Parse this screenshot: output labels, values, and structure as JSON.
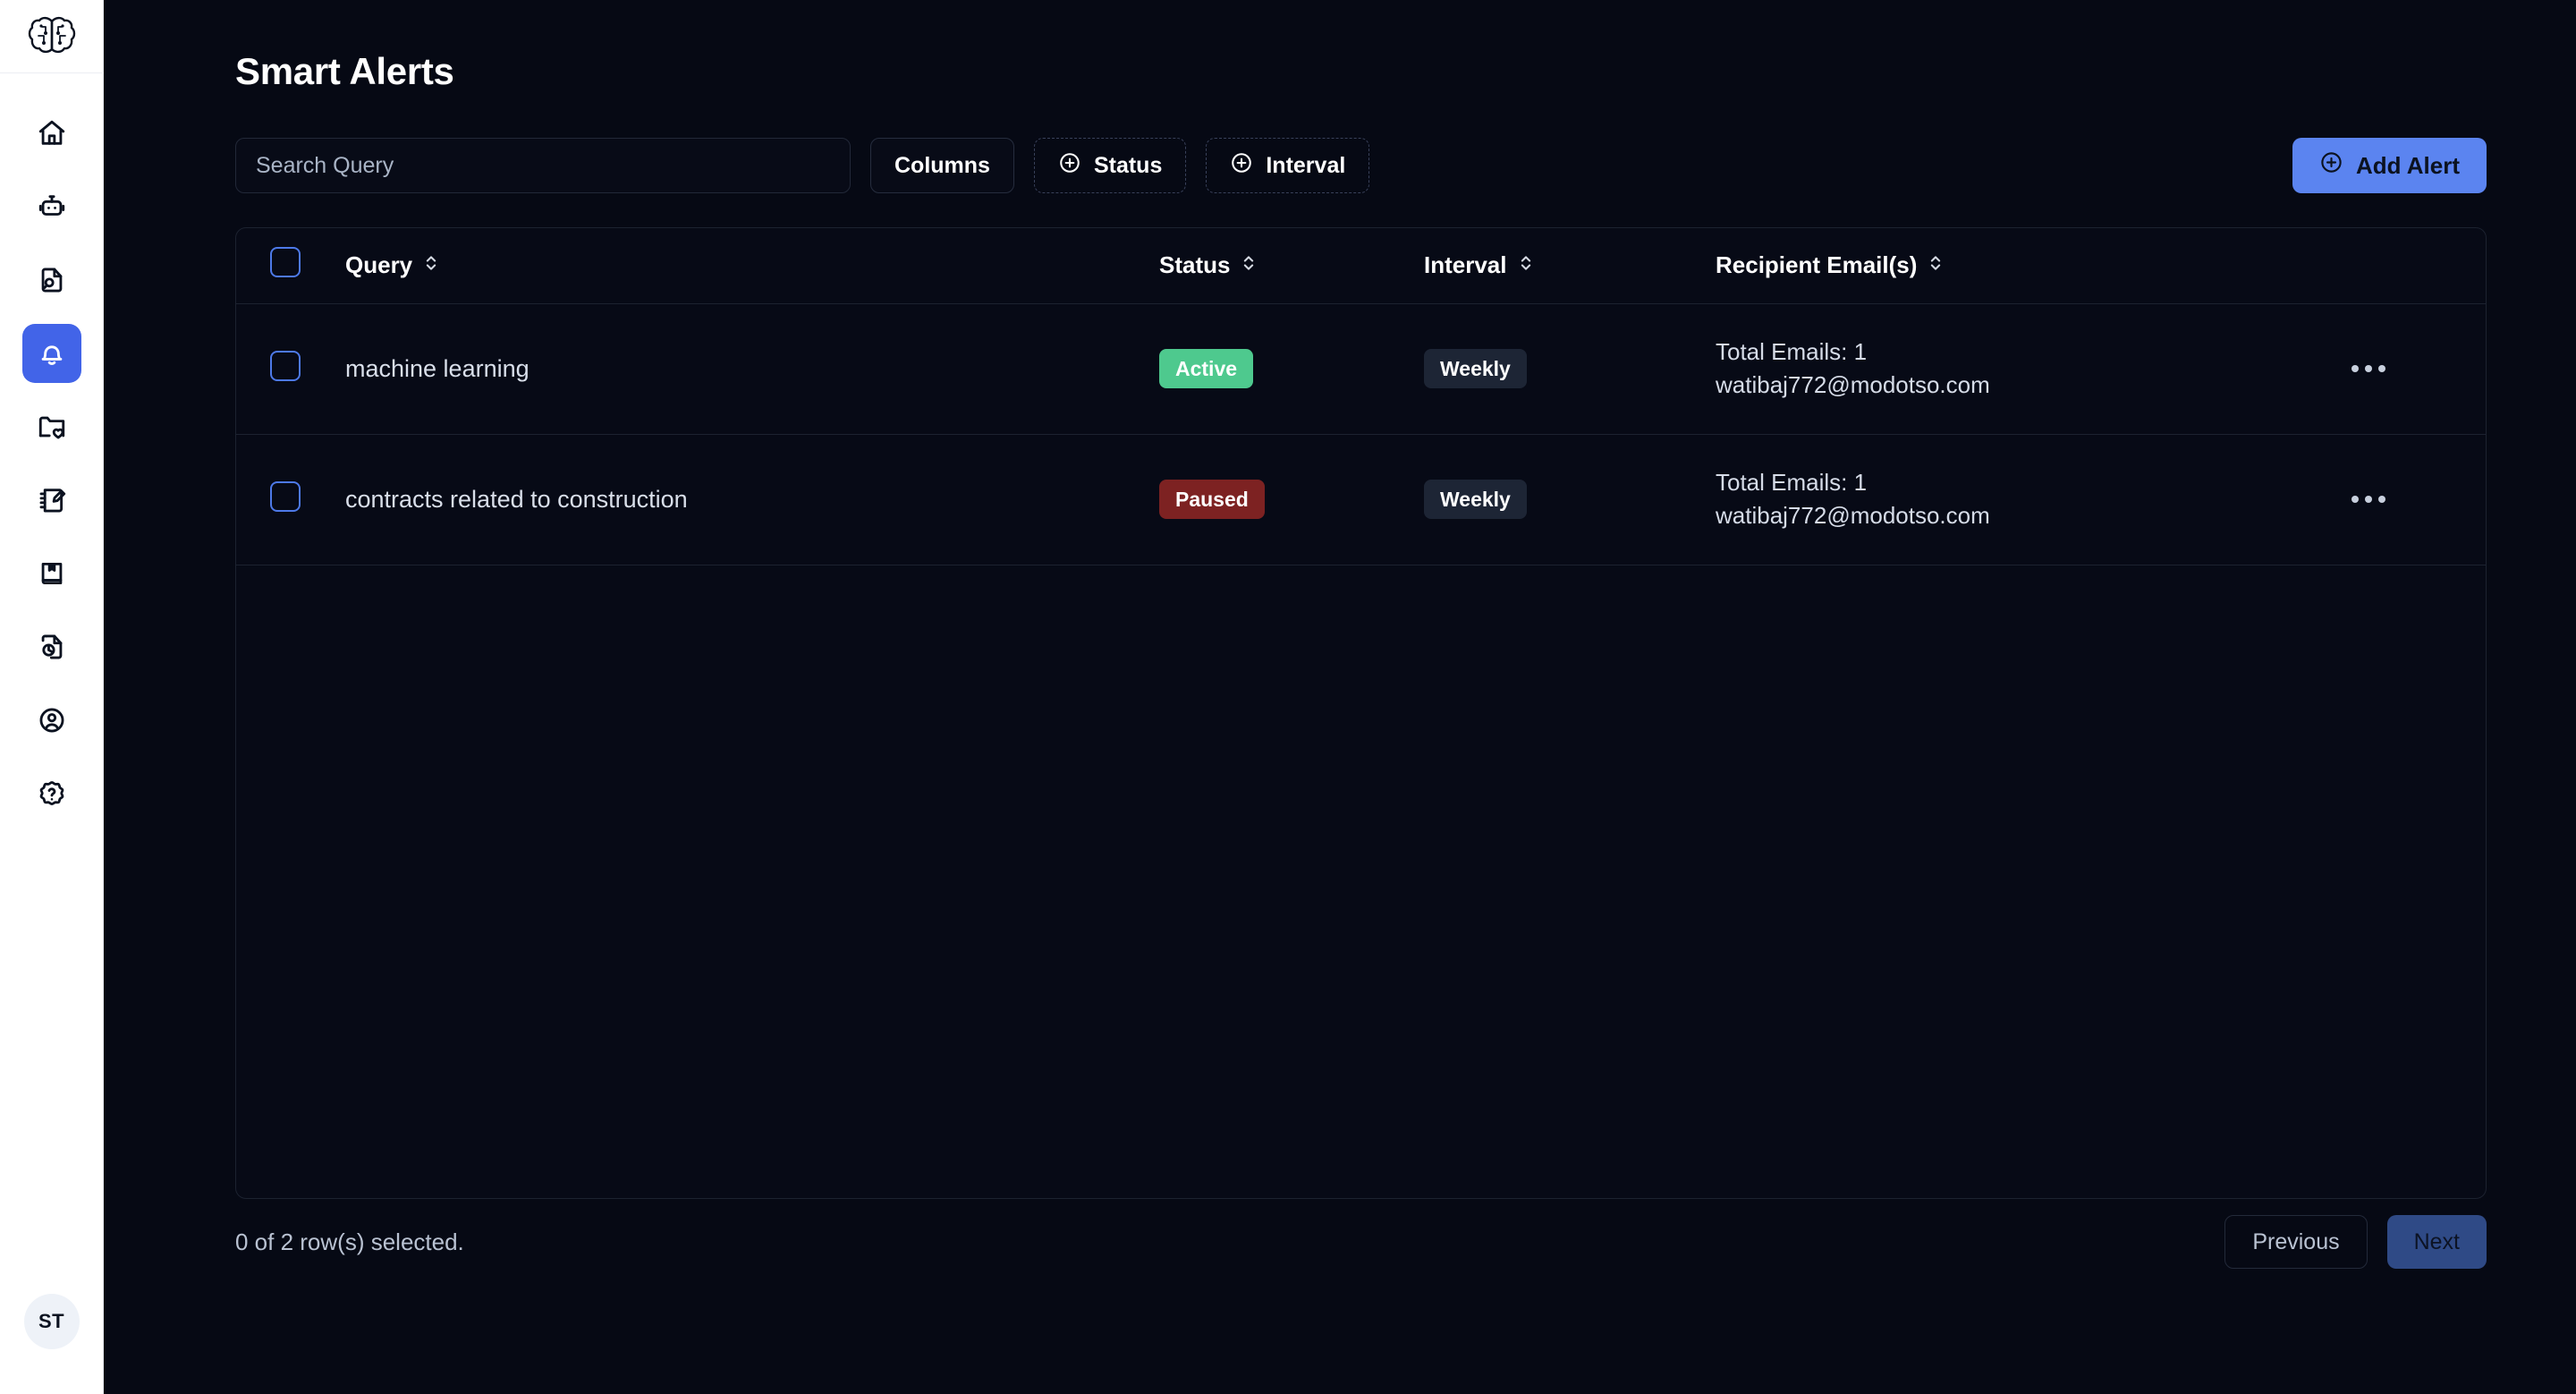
{
  "sidebar": {
    "logo": {
      "name": "brain-logo"
    },
    "items": [
      {
        "icon": "home-icon",
        "label": "Home",
        "active": false
      },
      {
        "icon": "robot-icon",
        "label": "Assistant",
        "active": false
      },
      {
        "icon": "file-search-icon",
        "label": "Search Docs",
        "active": false
      },
      {
        "icon": "bell-icon",
        "label": "Smart Alerts",
        "active": true
      },
      {
        "icon": "folder-heart-icon",
        "label": "Saved",
        "active": false
      },
      {
        "icon": "notebook-pen-icon",
        "label": "Notes",
        "active": false
      },
      {
        "icon": "book-bookmark-icon",
        "label": "Library",
        "active": false
      },
      {
        "icon": "file-chart-icon",
        "label": "Reports",
        "active": false
      },
      {
        "icon": "user-circle-icon",
        "label": "Account",
        "active": false
      },
      {
        "icon": "help-badge-icon",
        "label": "Help",
        "active": false
      }
    ],
    "avatar_initials": "ST"
  },
  "header": {
    "title": "Smart Alerts"
  },
  "toolbar": {
    "search_placeholder": "Search Query",
    "search_value": "",
    "columns_label": "Columns",
    "status_filter_label": "Status",
    "interval_filter_label": "Interval",
    "add_alert_label": "Add Alert"
  },
  "table": {
    "columns": [
      {
        "key": "query",
        "label": "Query",
        "sortable": true
      },
      {
        "key": "status",
        "label": "Status",
        "sortable": true
      },
      {
        "key": "interval",
        "label": "Interval",
        "sortable": true
      },
      {
        "key": "email",
        "label": "Recipient Email(s)",
        "sortable": true
      }
    ],
    "rows": [
      {
        "query": "machine learning",
        "status": "Active",
        "interval": "Weekly",
        "total_emails": "Total Emails: 1",
        "email": "watibaj772@modotso.com",
        "selected": false
      },
      {
        "query": "contracts related to construction",
        "status": "Paused",
        "interval": "Weekly",
        "total_emails": "Total Emails: 1",
        "email": "watibaj772@modotso.com",
        "selected": false
      }
    ]
  },
  "footer": {
    "rows_selected": "0 of 2 row(s) selected.",
    "previous_label": "Previous",
    "next_label": "Next"
  },
  "colors": {
    "page_bg": "#060914",
    "sidebar_bg": "#ffffff",
    "accent": "#4264e8",
    "add_button": "#5b84f0",
    "status_active": "#4ec98e",
    "status_paused": "#7d2222",
    "interval_badge": "#1d2535",
    "checkbox_border": "#4d79e8",
    "next_button": "#2f4a86"
  }
}
